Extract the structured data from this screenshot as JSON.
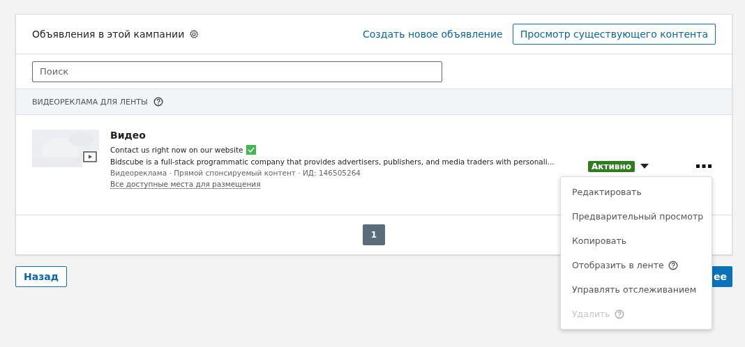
{
  "header": {
    "title": "Объявления в этой кампании",
    "create_link": "Создать новое объявление",
    "browse_button": "Просмотр существующего контента"
  },
  "search": {
    "placeholder": "Поиск"
  },
  "section": {
    "title": "ВИДЕОРЕКЛАМА ДЛЯ ЛЕНТЫ"
  },
  "ads": [
    {
      "kind": "picture",
      "title": "Видео",
      "headline": "Contact us right now on our website",
      "headline_check": true,
      "description": "Bidscube is a full-stack programmatic company that provides advertisers, publishers, and media traders with personali...",
      "meta": "Видеореклама · Прямой спонсируемый контент  · ИД: 146505264",
      "placements_link": "Все доступные места для размещения",
      "status": "Активно",
      "color": "#2f7d1e"
    }
  ],
  "pagination": [
    {
      "label": "1",
      "selected": true
    }
  ],
  "back_button": "Назад",
  "next_button": "ее",
  "menu": [
    {
      "label": "Редактировать",
      "help": false,
      "disabled": false
    },
    {
      "label": "Предварительный просмотр",
      "help": false,
      "disabled": false
    },
    {
      "label": "Копировать",
      "help": false,
      "disabled": false
    },
    {
      "label": "Отобразить в ленте",
      "help": true,
      "disabled": false
    },
    {
      "label": "Управлять отслеживанием",
      "help": false,
      "disabled": false
    },
    {
      "label": "Удалить",
      "help": true,
      "disabled": true
    }
  ]
}
